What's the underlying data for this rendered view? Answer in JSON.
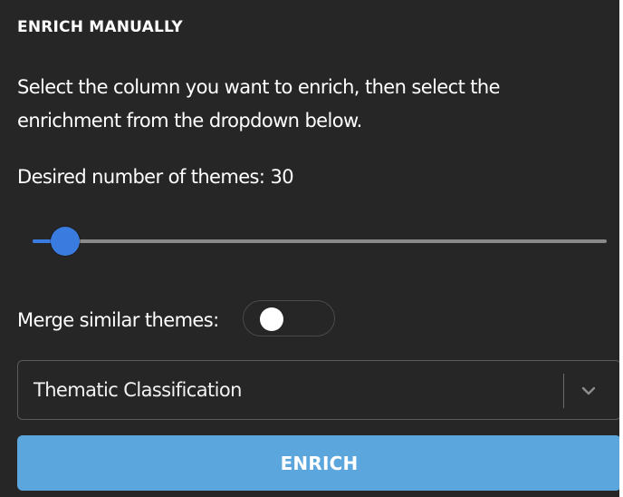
{
  "panel": {
    "title": "ENRICH MANUALLY",
    "description": "Select the column you want to enrich, then select the enrichment from the dropdown below."
  },
  "themes": {
    "label": "Desired number of themes: 30",
    "value": 30,
    "slider_fraction": 0.056
  },
  "merge": {
    "label": "Merge similar themes:",
    "enabled": false
  },
  "enrichment_select": {
    "value": "Thematic Classification",
    "chevron_icon": "chevron-down-icon"
  },
  "enrich_button": {
    "label": "ENRICH"
  },
  "colors": {
    "background": "#262626",
    "accent": "#3a7be0",
    "button": "#5aa6dd",
    "track": "#8a8a8a",
    "text": "#ffffff"
  }
}
